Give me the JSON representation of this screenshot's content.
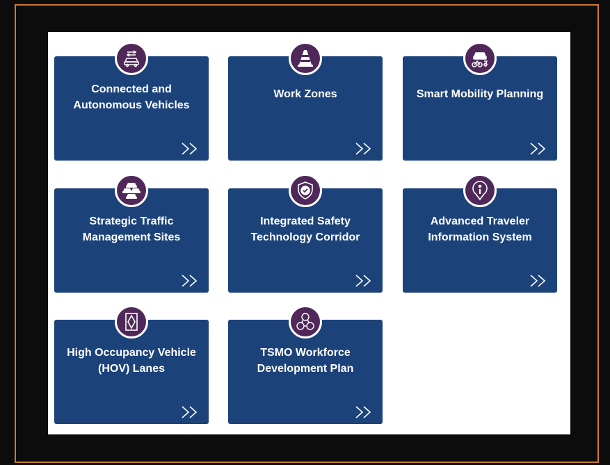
{
  "cards": [
    {
      "title_1": "Connected and",
      "title_2": "Autonomous Vehicles",
      "icon": "connected-car-icon"
    },
    {
      "title_1": "Work Zones",
      "title_2": "",
      "icon": "traffic-cone-icon"
    },
    {
      "title_1": "Smart Mobility Planning",
      "title_2": "",
      "icon": "mobility-icon"
    },
    {
      "title_1": "Strategic Traffic",
      "title_2": "Management Sites",
      "icon": "traffic-jam-icon"
    },
    {
      "title_1": "Integrated Safety",
      "title_2": "Technology Corridor",
      "icon": "shield-check-icon"
    },
    {
      "title_1": "Advanced Traveler",
      "title_2": "Information System",
      "icon": "info-pin-icon"
    },
    {
      "title_1": "High Occupancy Vehicle",
      "title_2": "(HOV) Lanes",
      "icon": "hov-diamond-icon"
    },
    {
      "title_1": "TSMO Workforce",
      "title_2": "Development Plan",
      "icon": "workforce-network-icon"
    }
  ],
  "colors": {
    "card_bg": "#1c427a",
    "badge_bg": "#4f2859",
    "frame_border": "#d07a2e"
  }
}
